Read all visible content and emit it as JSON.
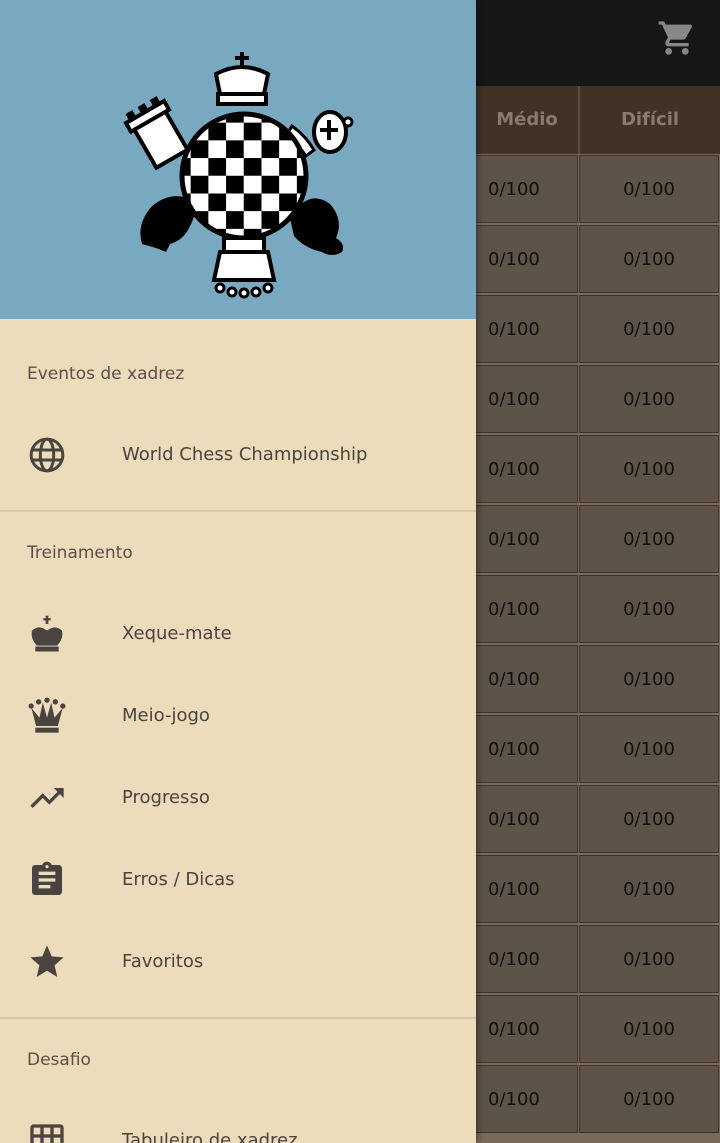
{
  "background": {
    "header": {
      "medium": "Médio",
      "hard": "Difícil"
    },
    "rows": [
      {
        "medium": "0/100",
        "hard": "0/100"
      },
      {
        "medium": "0/100",
        "hard": "0/100"
      },
      {
        "medium": "0/100",
        "hard": "0/100"
      },
      {
        "medium": "0/100",
        "hard": "0/100"
      },
      {
        "medium": "0/100",
        "hard": "0/100"
      },
      {
        "medium": "0/100",
        "hard": "0/100"
      },
      {
        "medium": "0/100",
        "hard": "0/100"
      },
      {
        "medium": "0/100",
        "hard": "0/100"
      },
      {
        "medium": "0/100",
        "hard": "0/100"
      },
      {
        "medium": "0/100",
        "hard": "0/100"
      },
      {
        "medium": "0/100",
        "hard": "0/100"
      },
      {
        "medium": "0/100",
        "hard": "0/100"
      },
      {
        "medium": "0/100",
        "hard": "0/100"
      },
      {
        "medium": "0/100",
        "hard": "0/100"
      }
    ]
  },
  "drawer": {
    "sections": [
      {
        "title": "Eventos de xadrez",
        "items": [
          {
            "label": "World Chess Championship",
            "icon": "globe-icon"
          }
        ]
      },
      {
        "title": "Treinamento",
        "items": [
          {
            "label": "Xeque-mate",
            "icon": "king-icon"
          },
          {
            "label": "Meio-jogo",
            "icon": "queen-icon"
          },
          {
            "label": "Progresso",
            "icon": "trending-up-icon"
          },
          {
            "label": "Erros / Dicas",
            "icon": "clipboard-icon"
          },
          {
            "label": "Favoritos",
            "icon": "star-icon"
          }
        ]
      },
      {
        "title": "Desafio",
        "items": [
          {
            "label": "Tabuleiro de xadrez",
            "icon": "grid-icon"
          }
        ]
      }
    ]
  },
  "colors": {
    "drawer_bg": "#ecdcbc",
    "header_bg": "#79a9c1",
    "icon": "#4a4340"
  }
}
